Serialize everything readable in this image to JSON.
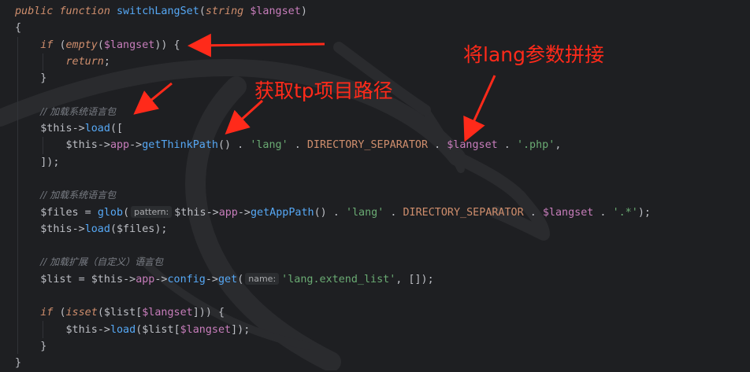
{
  "code_lines": [
    [
      [
        "kwi",
        "public "
      ],
      [
        "kwi",
        "function "
      ],
      [
        "fn",
        "switchLangSet"
      ],
      [
        "punc",
        "("
      ],
      [
        "kwi",
        "string "
      ],
      [
        "var",
        "$langset"
      ],
      [
        "punc",
        ")"
      ]
    ],
    [
      [
        "punc",
        "{"
      ]
    ],
    [
      [
        "plain",
        "    "
      ],
      [
        "kwi",
        "if "
      ],
      [
        "punc",
        "("
      ],
      [
        "kwi",
        "empty"
      ],
      [
        "punc",
        "("
      ],
      [
        "var",
        "$langset"
      ],
      [
        "punc",
        ")) {"
      ]
    ],
    [
      [
        "plain",
        "        "
      ],
      [
        "kwi",
        "return"
      ],
      [
        "punc",
        ";"
      ]
    ],
    [
      [
        "plain",
        "    "
      ],
      [
        "punc",
        "}"
      ]
    ],
    [],
    [
      [
        "plain",
        "    "
      ],
      [
        "cmt",
        "// 加载系统语言包"
      ]
    ],
    [
      [
        "plain",
        "    "
      ],
      [
        "plain",
        "$this"
      ],
      [
        "punc",
        "->"
      ],
      [
        "fn",
        "load"
      ],
      [
        "punc",
        "(["
      ]
    ],
    [
      [
        "plain",
        "        "
      ],
      [
        "plain",
        "$this"
      ],
      [
        "punc",
        "->"
      ],
      [
        "var",
        "app"
      ],
      [
        "punc",
        "->"
      ],
      [
        "fn",
        "getThinkPath"
      ],
      [
        "punc",
        "() . "
      ],
      [
        "str",
        "'lang'"
      ],
      [
        "punc",
        " . "
      ],
      [
        "kw",
        "DIRECTORY_SEPARATOR"
      ],
      [
        "punc",
        " . "
      ],
      [
        "var",
        "$langset"
      ],
      [
        "punc",
        " . "
      ],
      [
        "str",
        "'.php'"
      ],
      [
        "punc",
        ","
      ]
    ],
    [
      [
        "plain",
        "    "
      ],
      [
        "punc",
        "]);"
      ]
    ],
    [],
    [
      [
        "plain",
        "    "
      ],
      [
        "cmt",
        "// 加载系统语言包"
      ]
    ],
    [
      [
        "plain",
        "    "
      ],
      [
        "plain",
        "$files"
      ],
      [
        "punc",
        " = "
      ],
      [
        "fn",
        "glob"
      ],
      [
        "punc",
        "("
      ],
      [
        "hint",
        "pattern:"
      ],
      [
        "plain",
        "$this"
      ],
      [
        "punc",
        "->"
      ],
      [
        "var",
        "app"
      ],
      [
        "punc",
        "->"
      ],
      [
        "fn",
        "getAppPath"
      ],
      [
        "punc",
        "() . "
      ],
      [
        "str",
        "'lang'"
      ],
      [
        "punc",
        " . "
      ],
      [
        "kw",
        "DIRECTORY_SEPARATOR"
      ],
      [
        "punc",
        " . "
      ],
      [
        "var",
        "$langset"
      ],
      [
        "punc",
        " . "
      ],
      [
        "str",
        "'.*'"
      ],
      [
        "punc",
        ");"
      ]
    ],
    [
      [
        "plain",
        "    "
      ],
      [
        "plain",
        "$this"
      ],
      [
        "punc",
        "->"
      ],
      [
        "fn",
        "load"
      ],
      [
        "punc",
        "("
      ],
      [
        "plain",
        "$files"
      ],
      [
        "punc",
        ");"
      ]
    ],
    [],
    [
      [
        "plain",
        "    "
      ],
      [
        "cmt",
        "// 加载扩展（自定义）语言包"
      ]
    ],
    [
      [
        "plain",
        "    "
      ],
      [
        "plain",
        "$list"
      ],
      [
        "punc",
        " = "
      ],
      [
        "plain",
        "$this"
      ],
      [
        "punc",
        "->"
      ],
      [
        "var",
        "app"
      ],
      [
        "punc",
        "->"
      ],
      [
        "fn",
        "config"
      ],
      [
        "punc",
        "->"
      ],
      [
        "fn",
        "get"
      ],
      [
        "punc",
        "("
      ],
      [
        "hint",
        "name:"
      ],
      [
        "str",
        "'lang.extend_list'"
      ],
      [
        "punc",
        ", []);"
      ]
    ],
    [],
    [
      [
        "plain",
        "    "
      ],
      [
        "kwi",
        "if "
      ],
      [
        "punc",
        "("
      ],
      [
        "kwi",
        "isset"
      ],
      [
        "punc",
        "("
      ],
      [
        "plain",
        "$list"
      ],
      [
        "punc",
        "["
      ],
      [
        "var",
        "$langset"
      ],
      [
        "punc",
        "])) {"
      ]
    ],
    [
      [
        "plain",
        "        "
      ],
      [
        "plain",
        "$this"
      ],
      [
        "punc",
        "->"
      ],
      [
        "fn",
        "load"
      ],
      [
        "punc",
        "("
      ],
      [
        "plain",
        "$list"
      ],
      [
        "punc",
        "["
      ],
      [
        "var",
        "$langset"
      ],
      [
        "punc",
        "]);"
      ]
    ],
    [
      [
        "plain",
        "    "
      ],
      [
        "punc",
        "}"
      ]
    ],
    [
      [
        "punc",
        "}"
      ]
    ]
  ],
  "annotations": {
    "concat_lang_param": "将lang参数拼接",
    "get_tp_path": "获取tp项目路径"
  },
  "colors": {
    "background": "#1e1f22",
    "keyword": "#cf8e6d",
    "function": "#56a8f5",
    "variable": "#c77dbb",
    "string": "#6aab73",
    "comment": "#7a7e85",
    "annotation": "#ff2a1a"
  }
}
